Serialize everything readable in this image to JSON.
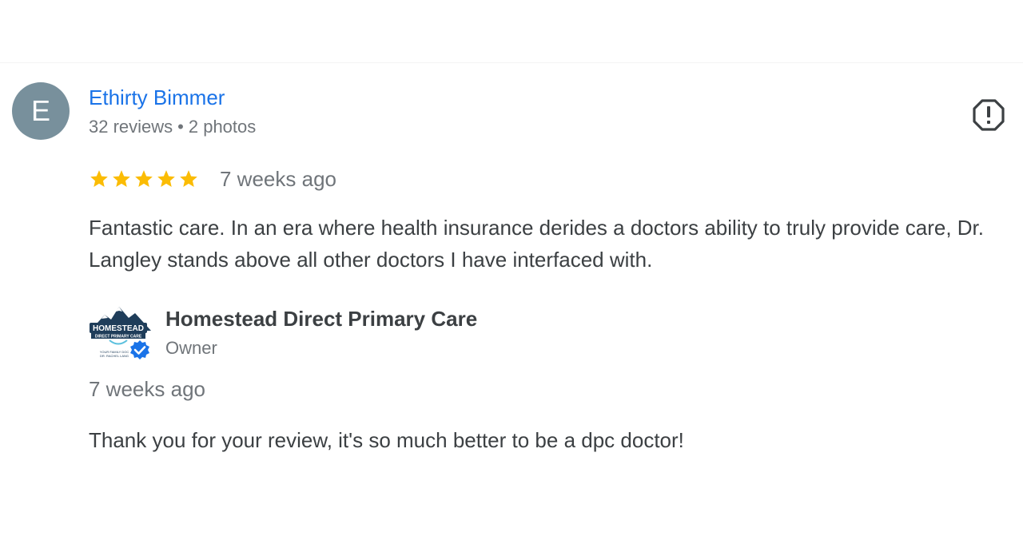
{
  "review": {
    "avatar_letter": "E",
    "avatar_color": "#78909c",
    "reviewer_name": "Ethirty Bimmer",
    "reviews_count": "32 reviews",
    "separator": "•",
    "photos_count": "2 photos",
    "rating": 5,
    "rating_max": 5,
    "star_color": "#fbbc04",
    "date": "7 weeks ago",
    "text": "Fantastic care. In an era where health insurance derides a doctors ability to truly provide care, Dr. Langley stands above all other doctors I have interfaced with.",
    "report_icon": "report-flag-icon"
  },
  "owner_response": {
    "logo_icon": "business-logo",
    "logo_text": "HOMESTEAD",
    "logo_subtext": "DIRECT PRIMARY CARE",
    "logo_tagline": "YOUR FAMILY DOC",
    "logo_tagline2": "DR. RACHEL LANG",
    "verified_icon": "verified-badge-icon",
    "name": "Homestead Direct Primary Care",
    "role": "Owner",
    "date": "7 weeks ago",
    "text": "Thank you for your review, it's so much better to be a dpc doctor!"
  },
  "colors": {
    "link": "#1a73e8",
    "secondary_text": "#70757a",
    "primary_text": "#3c4043",
    "verified": "#1a73e8"
  }
}
